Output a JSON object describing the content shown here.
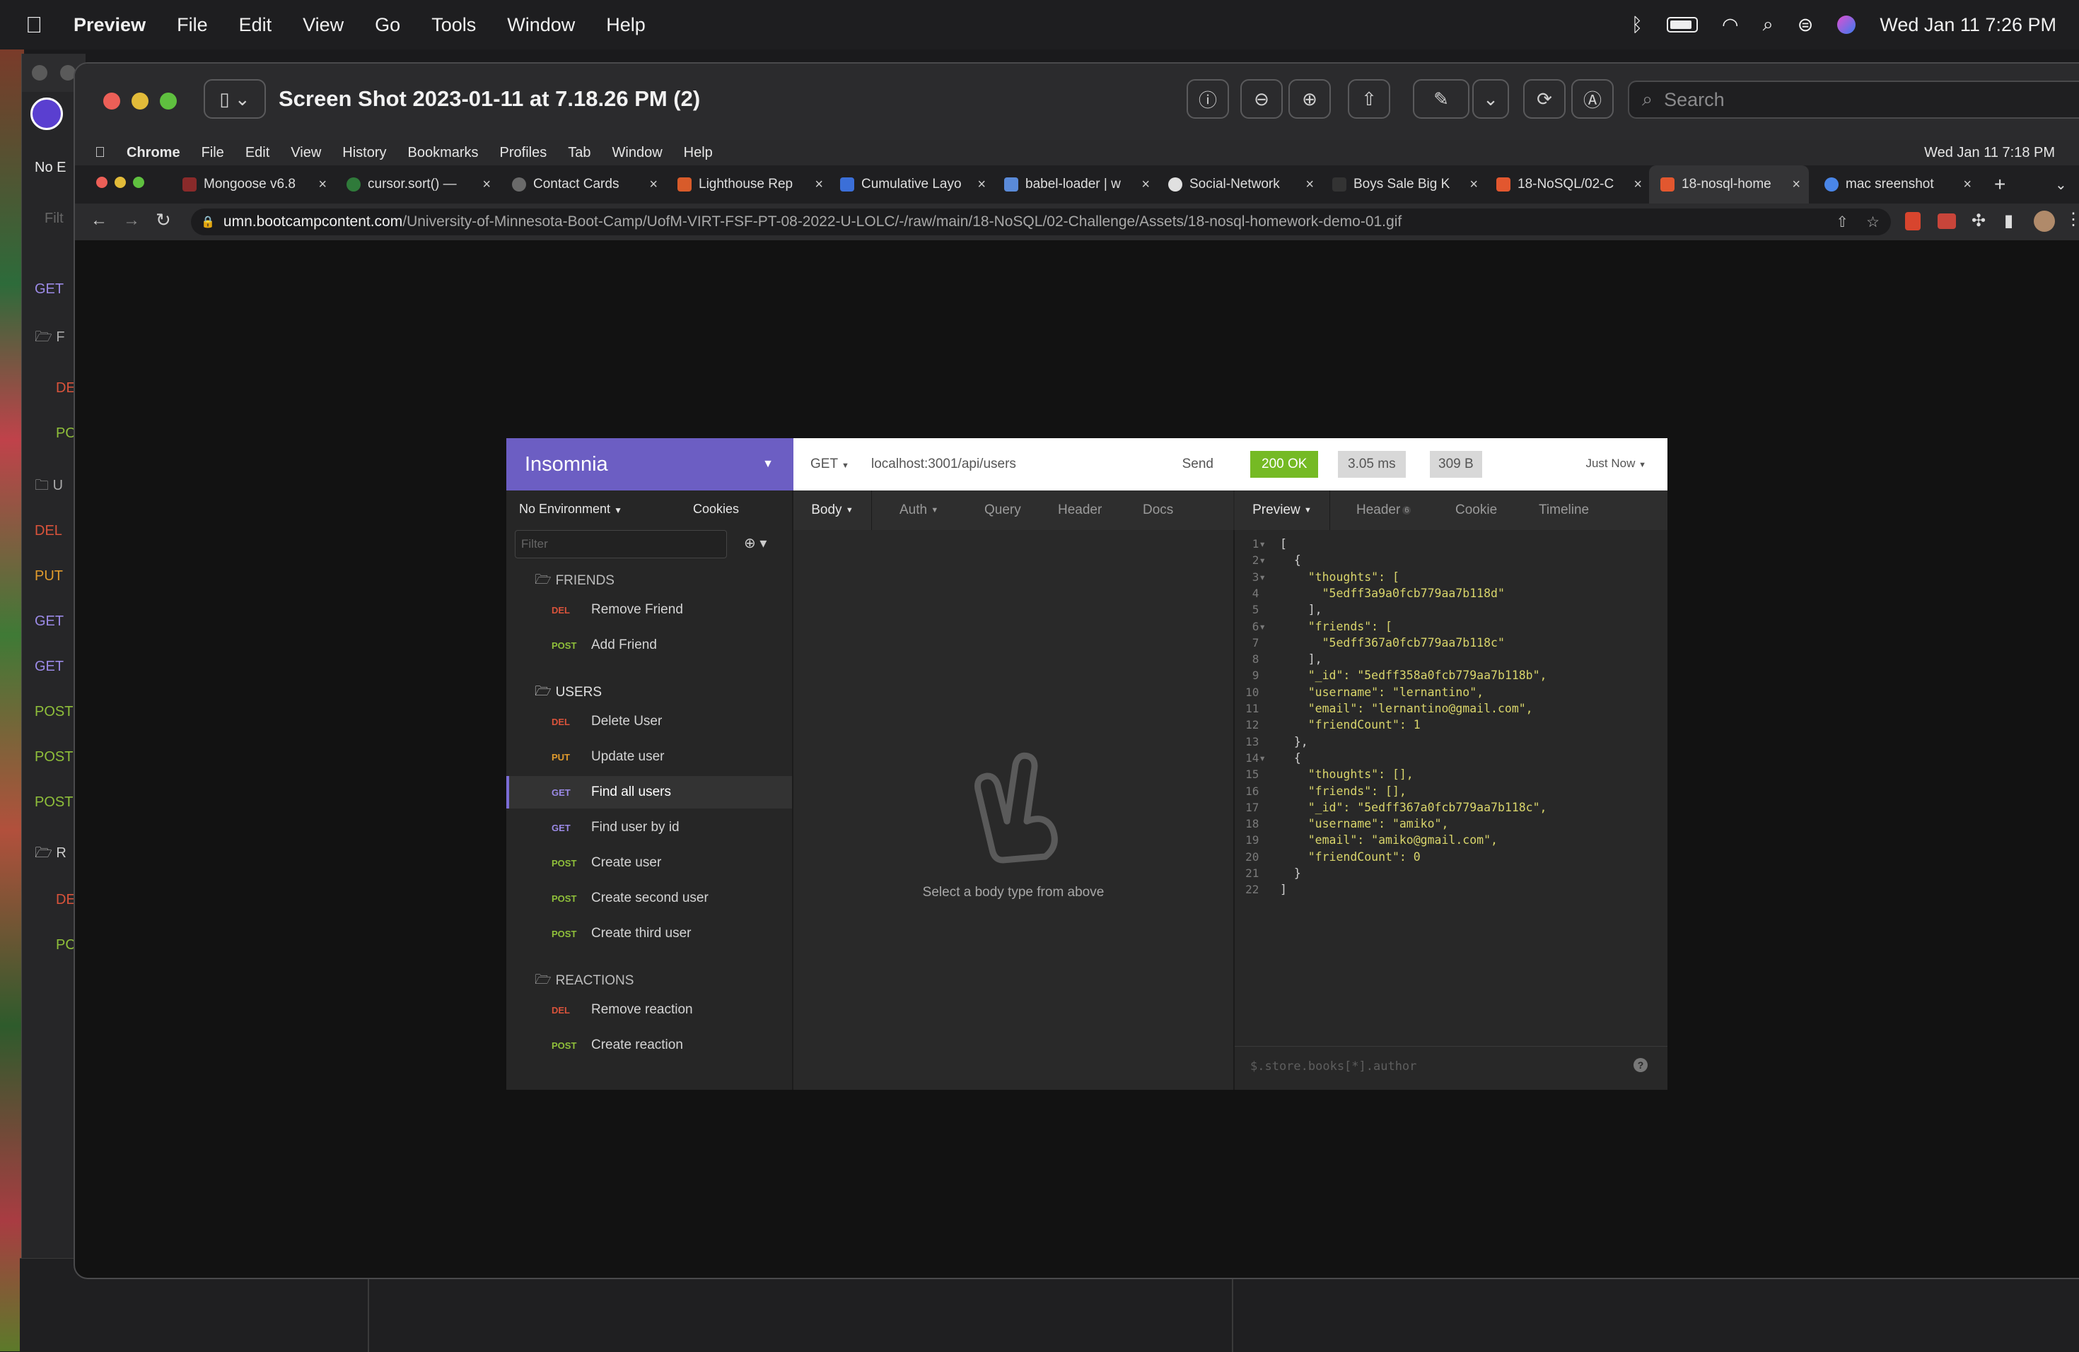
{
  "menubar": {
    "app": "Preview",
    "items": [
      "File",
      "Edit",
      "View",
      "Go",
      "Tools",
      "Window",
      "Help"
    ],
    "datetime": "Wed Jan 11  7:26 PM"
  },
  "background_window": {
    "labels": [
      "No E",
      "Filt",
      "GET",
      "F",
      "DE",
      "PO",
      "U",
      "DEL",
      "PUT",
      "GET",
      "GET",
      "POST",
      "POST",
      "POST",
      "R",
      "DE",
      "PC"
    ]
  },
  "preview": {
    "title": "Screen Shot 2023-01-11 at 7.18.26 PM (2)",
    "search_placeholder": "Search"
  },
  "chrome": {
    "menu": [
      "Chrome",
      "File",
      "Edit",
      "View",
      "History",
      "Bookmarks",
      "Profiles",
      "Tab",
      "Window",
      "Help"
    ],
    "datetime": "Wed Jan 11  7:18 PM",
    "tabs": [
      {
        "title": "Mongoose v6.8",
        "color": "#8a2a2a"
      },
      {
        "title": "cursor.sort() — ",
        "color": "#2f7a3a"
      },
      {
        "title": "Contact Cards",
        "color": "#6a6a6a"
      },
      {
        "title": "Lighthouse Rep",
        "color": "#d85b2a"
      },
      {
        "title": "Cumulative Layo",
        "color": "#3b6fd8"
      },
      {
        "title": "babel-loader | w",
        "color": "#5a8ad8"
      },
      {
        "title": "Social-Network",
        "color": "#e0e0e0"
      },
      {
        "title": "Boys Sale Big K",
        "color": "#333333"
      },
      {
        "title": "18-NoSQL/02-C",
        "color": "#e2572f"
      },
      {
        "title": "18-nosql-home",
        "color": "#e2572f"
      },
      {
        "title": "mac sreenshot",
        "color": "#4a86e8"
      }
    ],
    "url_host": "umn.bootcampcontent.com",
    "url_path": "/University-of-Minnesota-Boot-Camp/UofM-VIRT-FSF-PT-08-2022-U-LOLC/-/raw/main/18-NoSQL/02-Challenge/Assets/18-nosql-homework-demo-01.gif"
  },
  "insomnia": {
    "brand": "Insomnia",
    "environment": "No Environment",
    "cookies": "Cookies",
    "filter_placeholder": "Filter",
    "folders": [
      {
        "name": "FRIENDS",
        "items": [
          {
            "method": "DEL",
            "label": "Remove Friend"
          },
          {
            "method": "POST",
            "label": "Add Friend"
          }
        ]
      },
      {
        "name": "USERS",
        "items": [
          {
            "method": "DEL",
            "label": "Delete User"
          },
          {
            "method": "PUT",
            "label": "Update user"
          },
          {
            "method": "GET",
            "label": "Find all users"
          },
          {
            "method": "GET",
            "label": "Find user by id"
          },
          {
            "method": "POST",
            "label": "Create user"
          },
          {
            "method": "POST",
            "label": "Create second user"
          },
          {
            "method": "POST",
            "label": "Create third user"
          }
        ]
      },
      {
        "name": "REACTIONS",
        "items": [
          {
            "method": "DEL",
            "label": "Remove reaction"
          },
          {
            "method": "POST",
            "label": "Create reaction"
          }
        ]
      }
    ],
    "request": {
      "method": "GET",
      "url": "localhost:3001/api/users",
      "send": "Send",
      "tabs": [
        "Body",
        "Auth",
        "Query",
        "Header",
        "Docs"
      ],
      "empty_message": "Select a body type from above"
    },
    "response": {
      "status": "200 OK",
      "time": "3.05 ms",
      "size": "309 B",
      "when": "Just Now",
      "tabs": [
        "Preview",
        "Header",
        "Cookie",
        "Timeline"
      ],
      "header_count": "6",
      "filter_placeholder": "$.store.books[*].author",
      "lines": [
        "[",
        "  {",
        "    \"thoughts\": [",
        "      \"5edff3a9a0fcb779aa7b118d\"",
        "    ],",
        "    \"friends\": [",
        "      \"5edff367a0fcb779aa7b118c\"",
        "    ],",
        "    \"_id\": \"5edff358a0fcb779aa7b118b\",",
        "    \"username\": \"lernantino\",",
        "    \"email\": \"lernantino@gmail.com\",",
        "    \"friendCount\": 1",
        "  },",
        "  {",
        "    \"thoughts\": [],",
        "    \"friends\": [],",
        "    \"_id\": \"5edff367a0fcb779aa7b118c\",",
        "    \"username\": \"amiko\",",
        "    \"email\": \"amiko@gmail.com\",",
        "    \"friendCount\": 0",
        "  }",
        "]"
      ]
    }
  }
}
